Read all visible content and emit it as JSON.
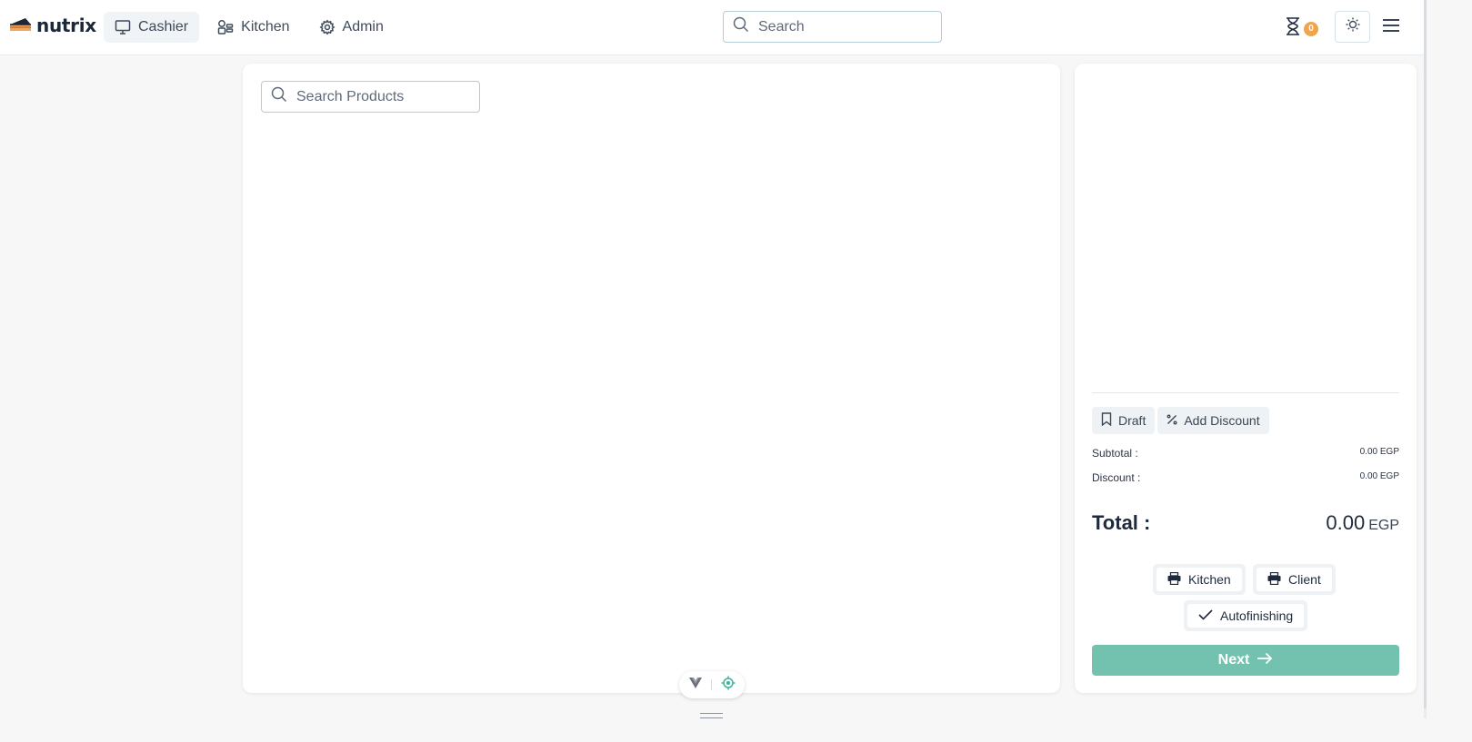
{
  "header": {
    "logo_text": "nutrix",
    "nav": [
      {
        "label": "Cashier",
        "icon": "monitor-icon",
        "active": true
      },
      {
        "label": "Kitchen",
        "icon": "kitchen-icon",
        "active": false
      },
      {
        "label": "Admin",
        "icon": "gear-icon",
        "active": false
      }
    ],
    "search_placeholder": "Search",
    "pending_count": "0",
    "icons": {
      "pending": "hourglass-icon",
      "theme": "sun-icon",
      "menu": "hamburger-menu-icon"
    }
  },
  "products": {
    "search_placeholder": "Search Products"
  },
  "cart": {
    "draft_label": "Draft",
    "discount_label": "Add Discount",
    "subtotal_label": "Subtotal :",
    "subtotal_value": "0.00 EGP",
    "discount_row_label": "Discount :",
    "discount_value": "0.00 EGP",
    "total_label": "Total :",
    "total_amount": "0.00",
    "total_currency": "EGP",
    "print_kitchen_label": "Kitchen",
    "print_client_label": "Client",
    "autofinishing_label": "Autofinishing",
    "next_label": "Next"
  },
  "colors": {
    "accent": "#72c2af",
    "badge": "#f0a44b",
    "text_dark": "#1f2a3d",
    "input_border": "#b3cdd8"
  }
}
